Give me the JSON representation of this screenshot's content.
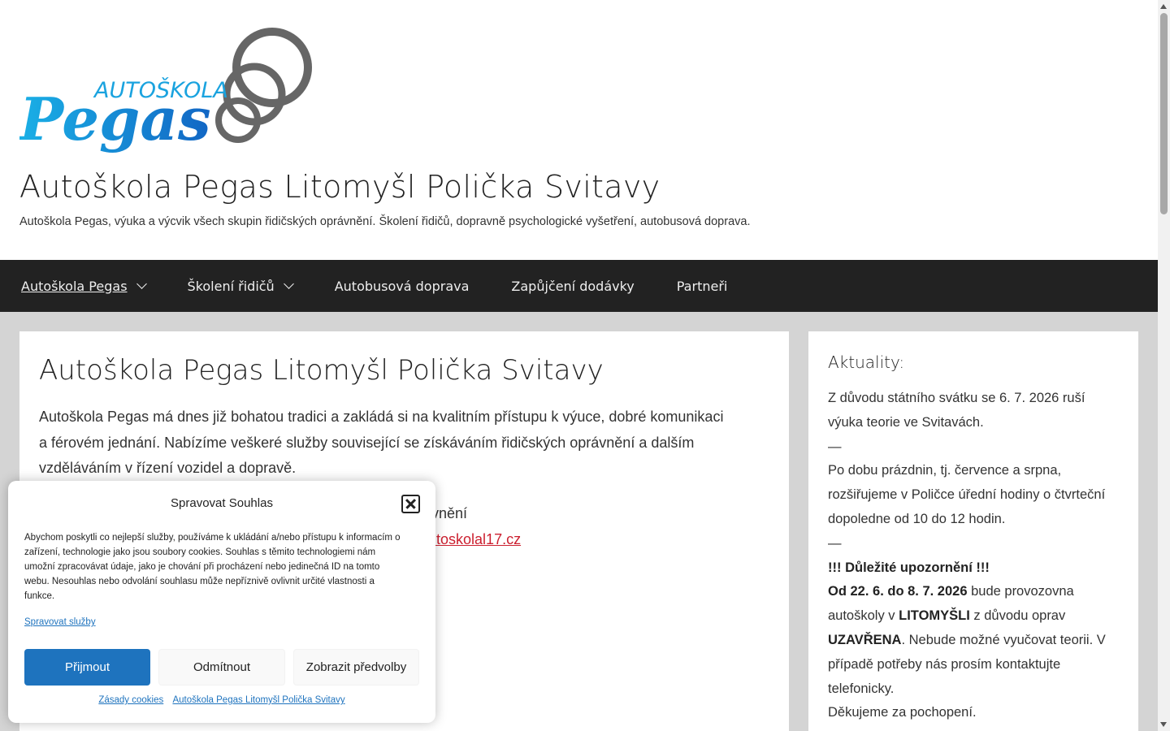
{
  "header": {
    "logo_top": "AUTOŠKOLA",
    "logo_main": "Pegas",
    "site_title": "Autoškola Pegas Litomyšl Polička Svitavy",
    "site_description": "Autoškola Pegas, výuka a výcvik všech skupin řidičských oprávnění. Školení řidičů, dopravně psychologické vyšetření, autobusová doprava."
  },
  "nav": {
    "items": [
      {
        "label": "Autoškola Pegas",
        "has_submenu": true,
        "active": true
      },
      {
        "label": "Školení řidičů",
        "has_submenu": true,
        "active": false
      },
      {
        "label": "Autobusová doprava",
        "has_submenu": false,
        "active": false
      },
      {
        "label": "Zapůjčení dodávky",
        "has_submenu": false,
        "active": false
      },
      {
        "label": "Partneři",
        "has_submenu": false,
        "active": false
      }
    ]
  },
  "main": {
    "title": "Autoškola Pegas Litomyšl Polička Svitavy",
    "intro_line1": "Autoškola Pegas má dnes již bohatou tradici a zakládá si na kvalitním přístupu k výuce, dobré komunikaci",
    "intro_line2": "a férovém jednání. Nabízíme veškeré služby související se získáváním řidičských oprávnění a dalším",
    "intro_line3": "vzděláváním v řízení vozidel a dopravě.",
    "partial_text": "vnění",
    "partial_link": "autoskolal17.cz"
  },
  "sidebar": {
    "title": "Aktuality:",
    "p1": "Z důvodu státního svátku se 6. 7. 2026 ruší výuka teorie ve Svitavách.",
    "dash1": "—",
    "p2": "Po dobu prázdnin, tj. července a srpna, rozšiřujeme v Poličce úřední hodiny o čtvrteční dopoledne od 10 do 12 hodin.",
    "dash2": "—",
    "warning": "!!! Důležité upozornění !!!",
    "date_range": "Od 22. 6. do 8. 7. 2026",
    "notice_a": " bude provozovna autoškoly v ",
    "place": "LITOMYŠLI",
    "notice_b": " z důvodu oprav ",
    "closed": "UZAVŘENA",
    "notice_c": ". Nebude možné vyučovat teorii. V případě potřeby nás prosím kontaktujte telefonicky.",
    "thanks": "Děkujeme za pochopení."
  },
  "cookie": {
    "title": "Spravovat Souhlas",
    "body": "Abychom poskytli co nejlepší služby, používáme k ukládání a/nebo přístupu k informacím o zařízení, technologie jako jsou soubory cookies. Souhlas s těmito technologiemi nám umožní zpracovávat údaje, jako je chování při procházení nebo jedinečná ID na tomto webu. Nesouhlas nebo odvolání souhlasu může nepříznivě ovlivnit určité vlastnosti a funkce.",
    "manage_link": "Spravovat služby",
    "accept": "Přijmout",
    "deny": "Odmítnout",
    "prefs": "Zobrazit předvolby",
    "link_cookies": "Zásady cookies",
    "link_site": "Autoškola Pegas Litomyšl Polička Svitavy"
  },
  "colors": {
    "brand_blue": "#1aa3df",
    "brand_dark_blue": "#1477c9",
    "ring_gray": "#666666",
    "nav_bg": "#222222",
    "accept_blue": "#1e73be",
    "link_red": "#cc2030"
  }
}
